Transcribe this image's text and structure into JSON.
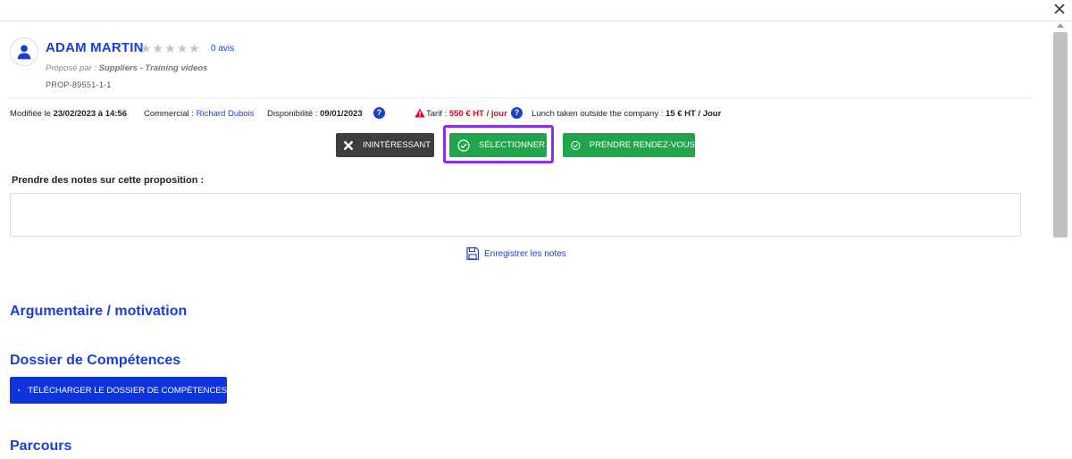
{
  "window": {
    "close_icon": "close-icon"
  },
  "profile": {
    "name": "ADAM MARTIN",
    "stars": "★★★★★",
    "reviews": "0 avis",
    "proposed_prefix": "Proposé par : ",
    "proposed_by": "Suppliers - Training videos",
    "reference": "PROP-89551-1-1",
    "avatar_icon": "user-icon"
  },
  "meta": {
    "modified_label": "Modifiée le ",
    "modified_value": "23/02/2023 à 14:56",
    "commercial_label": "Commercial : ",
    "commercial_value": "Richard Dubois",
    "availability_label": "Disponibilité : ",
    "availability_value": "09/01/2023",
    "tarif_label": "Tarif : ",
    "tarif_value": "550 € HT / jour",
    "lunch_label": "Lunch taken outside the company : ",
    "lunch_value": "15 € HT / Jour",
    "help_glyph": "?"
  },
  "actions": {
    "not_interested": "ININTÉRESSANT",
    "select": "SÉLECTIONNER",
    "appointment": "PRENDRE RENDEZ-VOUS"
  },
  "notes": {
    "label": "Prendre des notes sur cette proposition :",
    "value": "",
    "save": "Enregistrer les notes"
  },
  "sections": {
    "argumentaire": "Argumentaire / motivation",
    "dossier": "Dossier de Compétences",
    "download": "TÉLÉCHARGER LE DOSSIER DE COMPÉTENCES",
    "parcours": "Parcours"
  },
  "colors": {
    "accent": "#1a3ed8",
    "green": "#1fa64b",
    "dark": "#3d3d3d",
    "highlight": "#8c2fe8",
    "red": "#e4002b"
  }
}
